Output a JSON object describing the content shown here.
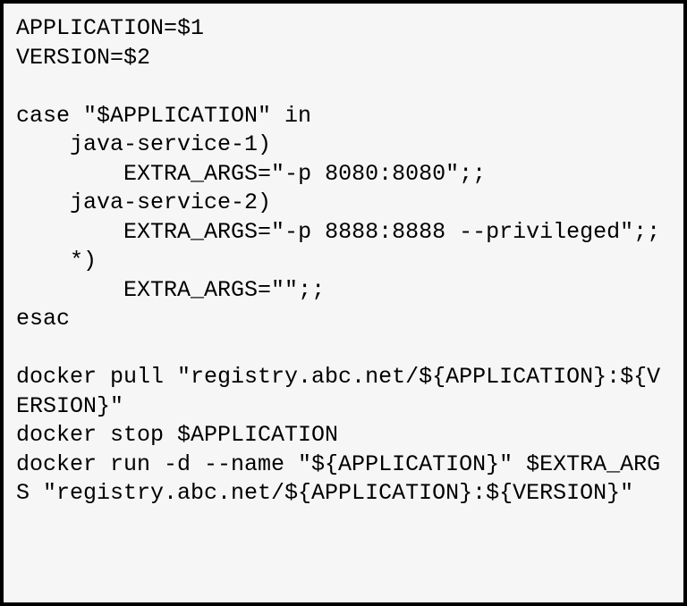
{
  "code": {
    "lines": [
      "APPLICATION=$1",
      "VERSION=$2",
      "",
      "case \"$APPLICATION\" in",
      "    java-service-1)",
      "        EXTRA_ARGS=\"-p 8080:8080\";;",
      "    java-service-2)",
      "        EXTRA_ARGS=\"-p 8888:8888 --privileged\";;",
      "    *)",
      "        EXTRA_ARGS=\"\";;",
      "esac",
      "",
      "docker pull \"registry.abc.net/${APPLICATION}:${VERSION}\"",
      "docker stop $APPLICATION",
      "docker run -d --name \"${APPLICATION}\" $EXTRA_ARGS \"registry.abc.net/${APPLICATION}:${VERSION}\""
    ]
  }
}
